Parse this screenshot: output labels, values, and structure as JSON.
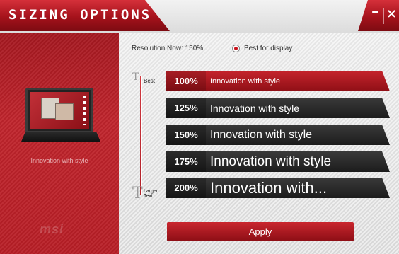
{
  "window": {
    "title": "SIZING OPTIONS",
    "minimize": "–",
    "close": "×"
  },
  "left_panel": {
    "caption": "Innovation with style",
    "logo": "msi"
  },
  "resolution": {
    "current": "Resolution Now: 150%",
    "best_option_label": "Best for display",
    "best_option_selected": true
  },
  "slider": {
    "top_label": "Best",
    "bottom_label_line1": "Larger",
    "bottom_label_line2": "Text"
  },
  "options": [
    {
      "percent": "100%",
      "text": "Innovation with style",
      "selected": true
    },
    {
      "percent": "125%",
      "text": "Innovation with style",
      "selected": false
    },
    {
      "percent": "150%",
      "text": "Innovation with style",
      "selected": false
    },
    {
      "percent": "175%",
      "text": "Innovation with style",
      "selected": false
    },
    {
      "percent": "200%",
      "text": "Innovation with...",
      "selected": false
    }
  ],
  "apply_label": "Apply",
  "colors": {
    "accent": "#c1232b",
    "dark_bar": "#2a2a2a"
  }
}
